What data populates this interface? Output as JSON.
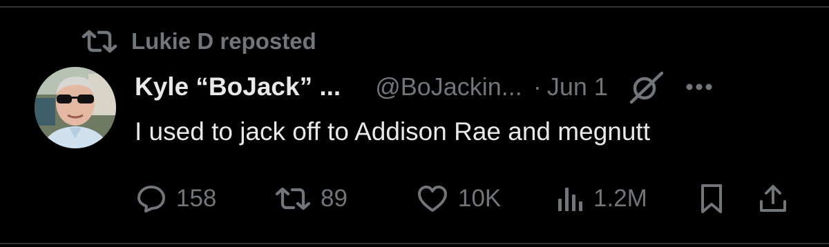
{
  "repost": {
    "label": "Lukie D reposted",
    "icon": "repost-icon"
  },
  "post": {
    "author_name": "Kyle “BoJack” ...",
    "author_handle": "@BoJackin...",
    "date_separator": "·",
    "date": "Jun 1",
    "text": "I used to jack off to Addison Rae and megnutt"
  },
  "actions": {
    "replies": "158",
    "reposts": "89",
    "likes": "10K",
    "views": "1.2M"
  },
  "colors": {
    "background": "#000000",
    "primary_text": "#e7e9ea",
    "secondary_text": "#71767b",
    "divider": "#2f3336"
  }
}
